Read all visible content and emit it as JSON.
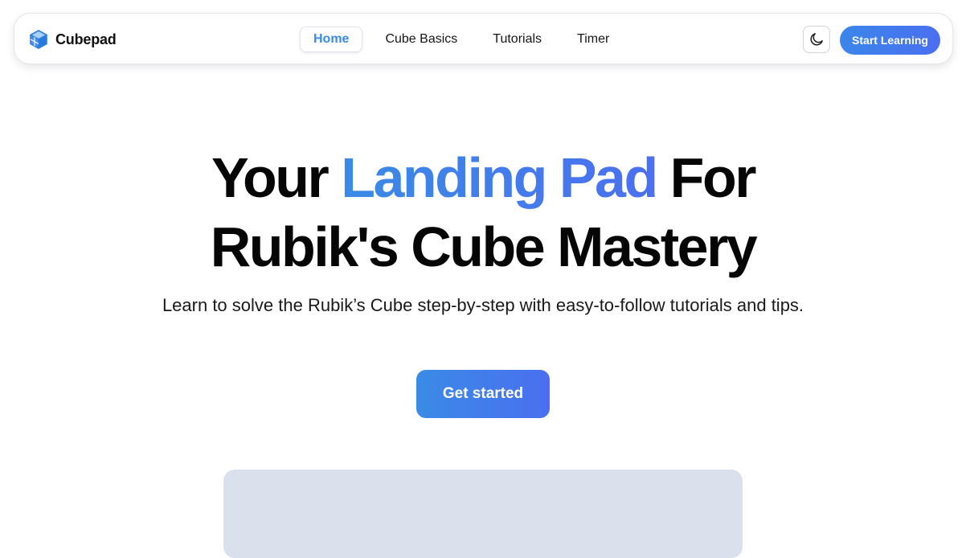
{
  "brand": {
    "name": "Cubepad",
    "icon": "cube-icon"
  },
  "nav": {
    "links": [
      {
        "label": "Home",
        "active": true
      },
      {
        "label": "Cube Basics",
        "active": false
      },
      {
        "label": "Tutorials",
        "active": false
      },
      {
        "label": "Timer",
        "active": false
      }
    ],
    "theme_toggle_icon": "moon-icon",
    "cta_label": "Start Learning"
  },
  "hero": {
    "title_prefix": "Your ",
    "title_highlight": "Landing Pad",
    "title_suffix_line1": " For",
    "title_line2": "Rubik's Cube Mastery",
    "subtitle": "Learn to solve the Rubik’s Cube step-by-step with easy-to-follow tutorials and tips.",
    "cta_label": "Get started"
  },
  "colors": {
    "accent": "#3a8be6",
    "accent_end": "#4a6ff0",
    "preview_card": "#dae1ec"
  }
}
